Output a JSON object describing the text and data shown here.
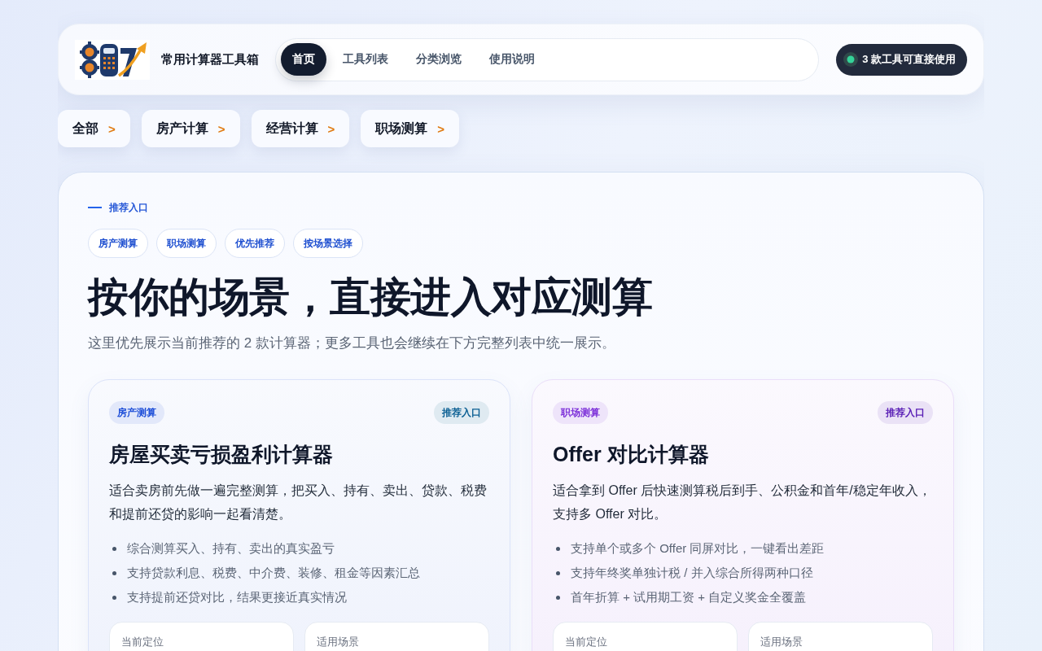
{
  "header": {
    "title": "常用计算器工具箱",
    "nav": [
      {
        "label": "首页",
        "selected": true
      },
      {
        "label": "工具列表",
        "selected": false
      },
      {
        "label": "分类浏览",
        "selected": false
      },
      {
        "label": "使用说明",
        "selected": false
      }
    ],
    "status": {
      "label": "3 款工具可直接使用"
    }
  },
  "categories": [
    {
      "label": "全部",
      "arrow": ">"
    },
    {
      "label": "房产计算",
      "arrow": ">"
    },
    {
      "label": "经营计算",
      "arrow": ">"
    },
    {
      "label": "职场测算",
      "arrow": ">"
    }
  ],
  "hero": {
    "eyebrow": "推荐入口",
    "tags": [
      "房产测算",
      "职场测算",
      "优先推荐",
      "按场景选择"
    ],
    "heading": "按你的场景，直接进入对应测算",
    "subtitle": "这里优先展示当前推荐的 2 款计算器；更多工具也会继续在下方完整列表中统一展示。"
  },
  "cards": [
    {
      "tag": {
        "label": "房产测算",
        "color": "#1d4ed8"
      },
      "badge": {
        "label": "推荐入口",
        "color": "#0b5f93"
      },
      "title": "房屋买卖亏损盈利计算器",
      "description": "适合卖房前先做一遍完整测算，把买入、持有、卖出、贷款、税费和提前还贷的影响一起看清楚。",
      "points": [
        "综合测算买入、持有、卖出的真实盈亏",
        "支持贷款利息、税费、中介费、装修、租金等因素汇总",
        "支持提前还贷对比，结果更接近真实情况"
      ],
      "facts": [
        "当前定位",
        "适用场景"
      ]
    },
    {
      "tag": {
        "label": "职场测算",
        "color": "#7c2fd9"
      },
      "badge": {
        "label": "推荐入口",
        "color": "#5b21b6"
      },
      "title": "Offer 对比计算器",
      "description": "适合拿到 Offer 后快速测算税后到手、公积金和首年/稳定年收入，支持多 Offer 对比。",
      "points": [
        "支持单个或多个 Offer 同屏对比，一键看出差距",
        "支持年终奖单独计税 / 并入综合所得两种口径",
        "首年折算 + 试用期工资 + 自定义奖金全覆盖"
      ],
      "facts": [
        "当前定位",
        "适用场景"
      ]
    }
  ]
}
